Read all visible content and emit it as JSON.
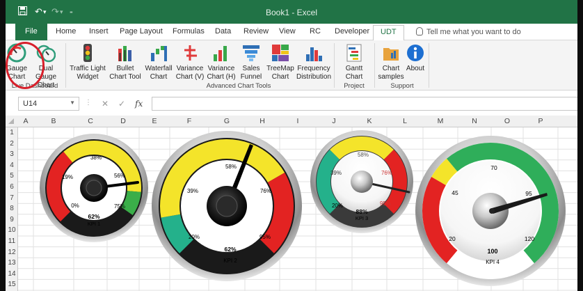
{
  "window": {
    "title": "Book1 - Excel"
  },
  "quick_access": {
    "save_icon": "save-icon",
    "undo_icon": "undo-icon",
    "redo_icon": "redo-icon",
    "customize_icon": "customize-icon"
  },
  "tabs": [
    "File",
    "Home",
    "Insert",
    "Page Layout",
    "Formulas",
    "Data",
    "Review",
    "View",
    "RC",
    "Developer",
    "UDT"
  ],
  "active_tab": "UDT",
  "tell_me": "Tell me what you want to do",
  "ribbon": {
    "gauge_chart": [
      "Gauge",
      "Chart"
    ],
    "dual_gauge_chart": [
      "Dual Gauge",
      "Chart"
    ],
    "traffic_light": [
      "Traffic Light",
      "Widget"
    ],
    "bullet_chart": [
      "Bullet",
      "Chart Tool"
    ],
    "waterfall_chart": [
      "Waterfall",
      "Chart"
    ],
    "variance_v": [
      "Variance",
      "Chart (V)"
    ],
    "variance_h": [
      "Variance",
      "Chart (H)"
    ],
    "sales_funnel": [
      "Sales",
      "Funnel"
    ],
    "treemap": [
      "TreeMap",
      "Chart"
    ],
    "frequency": [
      "Frequency",
      "Distribution"
    ],
    "gantt": [
      "Gantt",
      "Chart"
    ],
    "chart_samples": [
      "Chart",
      "samples"
    ],
    "about": "About",
    "groups": {
      "live_dashboard": "Live Dashboard Tools",
      "advanced_chart": "Advanced Chart Tools",
      "project": "Project Tools",
      "support": "Support"
    }
  },
  "formula_bar": {
    "name_box": "U14",
    "cancel_glyph": "✕",
    "enter_glyph": "✓",
    "fx_label": "fx",
    "value": ""
  },
  "columns": [
    "A",
    "B",
    "C",
    "D",
    "E",
    "F",
    "G",
    "H",
    "I",
    "J",
    "K",
    "L",
    "M",
    "N",
    "O",
    "P"
  ],
  "rows": [
    "1",
    "2",
    "3",
    "4",
    "5",
    "6",
    "7",
    "8",
    "9",
    "10",
    "11",
    "12",
    "13",
    "14",
    "15"
  ],
  "gauges": {
    "kpi1": {
      "labels": [
        "0%",
        "19%",
        "38%",
        "56%",
        "75%"
      ],
      "value": "62%",
      "name": "KPI 1",
      "colors": [
        "#e32322",
        "#f4e42a",
        "#3aae49"
      ]
    },
    "kpi2": {
      "labels": [
        "20%",
        "39%",
        "58%",
        "76%",
        "95%"
      ],
      "value": "62%",
      "name": "KPI 2",
      "colors": [
        "#24b18b",
        "#f4e42a",
        "#e32322"
      ]
    },
    "kpi3": {
      "labels": [
        "20%",
        "39%",
        "58%",
        "76%",
        "95%"
      ],
      "value": "88%",
      "name": "KPI 3",
      "colors": [
        "#24b18b",
        "#f4e42a",
        "#e32322"
      ]
    },
    "kpi4": {
      "labels": [
        "20",
        "45",
        "70",
        "95",
        "120"
      ],
      "value": "100",
      "name": "KPI 4",
      "colors": [
        "#e32322",
        "#f4e42a",
        "#2fae5a"
      ]
    }
  }
}
